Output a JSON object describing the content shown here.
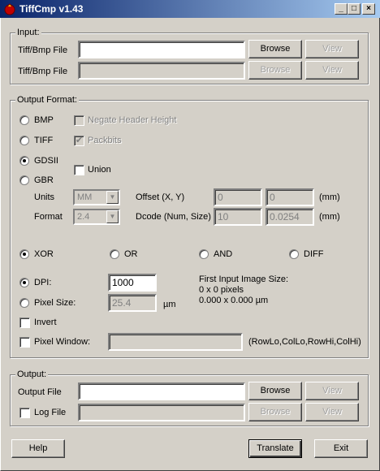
{
  "window": {
    "title": "TiffCmp v1.43",
    "controls": {
      "minimize": "_",
      "maximize": "□",
      "close": "×"
    }
  },
  "input": {
    "group_label": "Input:",
    "file1_label": "Tiff/Bmp File",
    "file1_value": "",
    "file2_label": "Tiff/Bmp File",
    "file2_value": "",
    "browse_label": "Browse",
    "view_label": "View"
  },
  "output_format": {
    "group_label": "Output Format:",
    "formats": [
      "BMP",
      "TIFF",
      "GDSII",
      "GBR"
    ],
    "selected_format": "GDSII",
    "negate_header_height": "Negate Header Height",
    "packbits": "Packbits",
    "union": "Union",
    "units_label": "Units",
    "units_value": "MM",
    "format_label": "Format",
    "format_value": "2.4",
    "offset_label": "Offset (X, Y)",
    "offset_x": "0",
    "offset_y": "0",
    "offset_unit": "(mm)",
    "dcode_label": "Dcode (Num, Size)",
    "dcode_num": "10",
    "dcode_size": "0.0254",
    "dcode_unit": "(mm)",
    "operations": [
      "XOR",
      "OR",
      "AND",
      "DIFF"
    ],
    "selected_operation": "XOR",
    "dpi_label": "DPI:",
    "dpi_value": "1000",
    "pixel_size_label": "Pixel Size:",
    "pixel_size_value": "25.4",
    "pixel_size_unit": "µm",
    "image_size_title": "First Input Image Size:",
    "image_size_pixels": "0 x 0 pixels",
    "image_size_um": "0.000 x 0.000 µm",
    "invert_label": "Invert",
    "pixel_window_label": "Pixel Window:",
    "pixel_window_value": "",
    "pixel_window_hint": "(RowLo,ColLo,RowHi,ColHi)"
  },
  "output": {
    "group_label": "Output:",
    "output_file_label": "Output File",
    "output_file_value": "",
    "log_file_label": "Log File",
    "log_file_value": "",
    "browse_label": "Browse",
    "view_label": "View"
  },
  "footer": {
    "help_label": "Help",
    "translate_label": "Translate",
    "exit_label": "Exit"
  },
  "colors": {
    "titlebar_start": "#0a246a",
    "titlebar_end": "#a6caf0",
    "face": "#d4d0c8"
  }
}
